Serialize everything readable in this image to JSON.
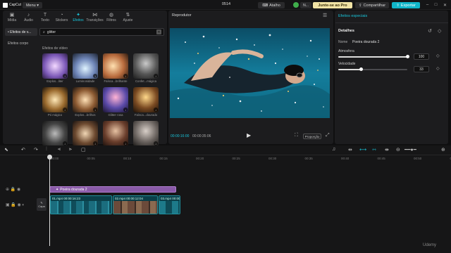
{
  "titlebar": {
    "app_name": "CapCut",
    "menu_label": "Menu ▾",
    "project_title": "0514",
    "shortcut_label": "Atalho",
    "user_label": "N...",
    "pro_label": "Junte-se ao Pro",
    "share_label": "Compartilhar",
    "export_label": "Exportar",
    "accent_color": "#19c5da"
  },
  "tools": [
    {
      "label": "Mídia",
      "icon": "media-icon",
      "glyph": "▣"
    },
    {
      "label": "Áudio",
      "icon": "audio-icon",
      "glyph": "♪"
    },
    {
      "label": "Texto",
      "icon": "text-icon",
      "glyph": "T"
    },
    {
      "label": "Stickers",
      "icon": "sticker-icon",
      "glyph": "◔"
    },
    {
      "label": "Efeitos",
      "icon": "effects-icon",
      "glyph": "✦"
    },
    {
      "label": "Transições",
      "icon": "transitions-icon",
      "glyph": "⋈"
    },
    {
      "label": "Filtros",
      "icon": "filters-icon",
      "glyph": "◍"
    },
    {
      "label": "Ajuste",
      "icon": "adjust-icon",
      "glyph": "⇅"
    }
  ],
  "active_tool_index": 4,
  "sidebar": {
    "items": [
      {
        "label": "• Efeitos de v..."
      },
      {
        "label": "Efeitos corpo"
      }
    ]
  },
  "search": {
    "value": "glitter"
  },
  "effects": {
    "section_label": "Efeitos de vídeo",
    "items": [
      {
        "label": "Explos...liter"
      },
      {
        "label": "Luminosidade"
      },
      {
        "label": "Faísca...brilhante"
      },
      {
        "label": "Confet...mágica"
      },
      {
        "label": "Pó mágico"
      },
      {
        "label": "Explos...brilhos"
      },
      {
        "label": "Glitter rosa"
      },
      {
        "label": "Faísca...dourado"
      },
      {
        "label": ""
      },
      {
        "label": ""
      },
      {
        "label": ""
      },
      {
        "label": ""
      }
    ]
  },
  "player": {
    "title": "Reprodutor",
    "time_current": "00:00:16:00",
    "time_total": "00:00:35:06",
    "ratio_label": "Proporção"
  },
  "right_panel": {
    "tab_label": "Efeitos especiais",
    "details_label": "Detalhes",
    "name_key": "Nome",
    "name_value": "Poeira dourada 2",
    "params": [
      {
        "label": "Atmosfera",
        "value": "100",
        "fraction": 1.0
      },
      {
        "label": "Velocidade",
        "value": "33",
        "fraction": 0.33
      }
    ]
  },
  "timeline": {
    "ticks": [
      "00:00",
      "00:05",
      "00:10",
      "00:15",
      "00:20",
      "00:25",
      "00:30",
      "00:35",
      "00:40",
      "00:45",
      "00:50",
      "00:55"
    ],
    "effect_clip_label": "Poeira dourada 2",
    "cover_label": "Capa",
    "clips": [
      {
        "label": "01.mp4  00:00:16:23"
      },
      {
        "label": "02.mp4  00:00:12:04"
      },
      {
        "label": "03.mp4  00:00"
      }
    ]
  },
  "watermark": "Udemy"
}
